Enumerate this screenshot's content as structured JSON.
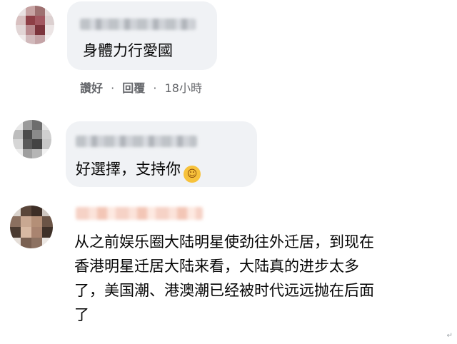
{
  "comments": [
    {
      "text": "身體力行愛國",
      "actions": {
        "like_label": "讚好",
        "reply_label": "回覆",
        "time": "18小時"
      }
    },
    {
      "text": "好選擇，支持你",
      "emoji": "smiling-face-icon"
    },
    {
      "text_lines": [
        "从之前娱乐圈大陆明星使劲往外迁居，到现在",
        "香港明星迁居大陆来看，大陆真的进步太多",
        "了，美国潮、港澳潮已经被时代远远抛在后面",
        "了"
      ]
    }
  ],
  "separator": "·",
  "colors": {
    "bubble": "#f0f2f5",
    "meta": "#65676b",
    "text": "#050505"
  }
}
